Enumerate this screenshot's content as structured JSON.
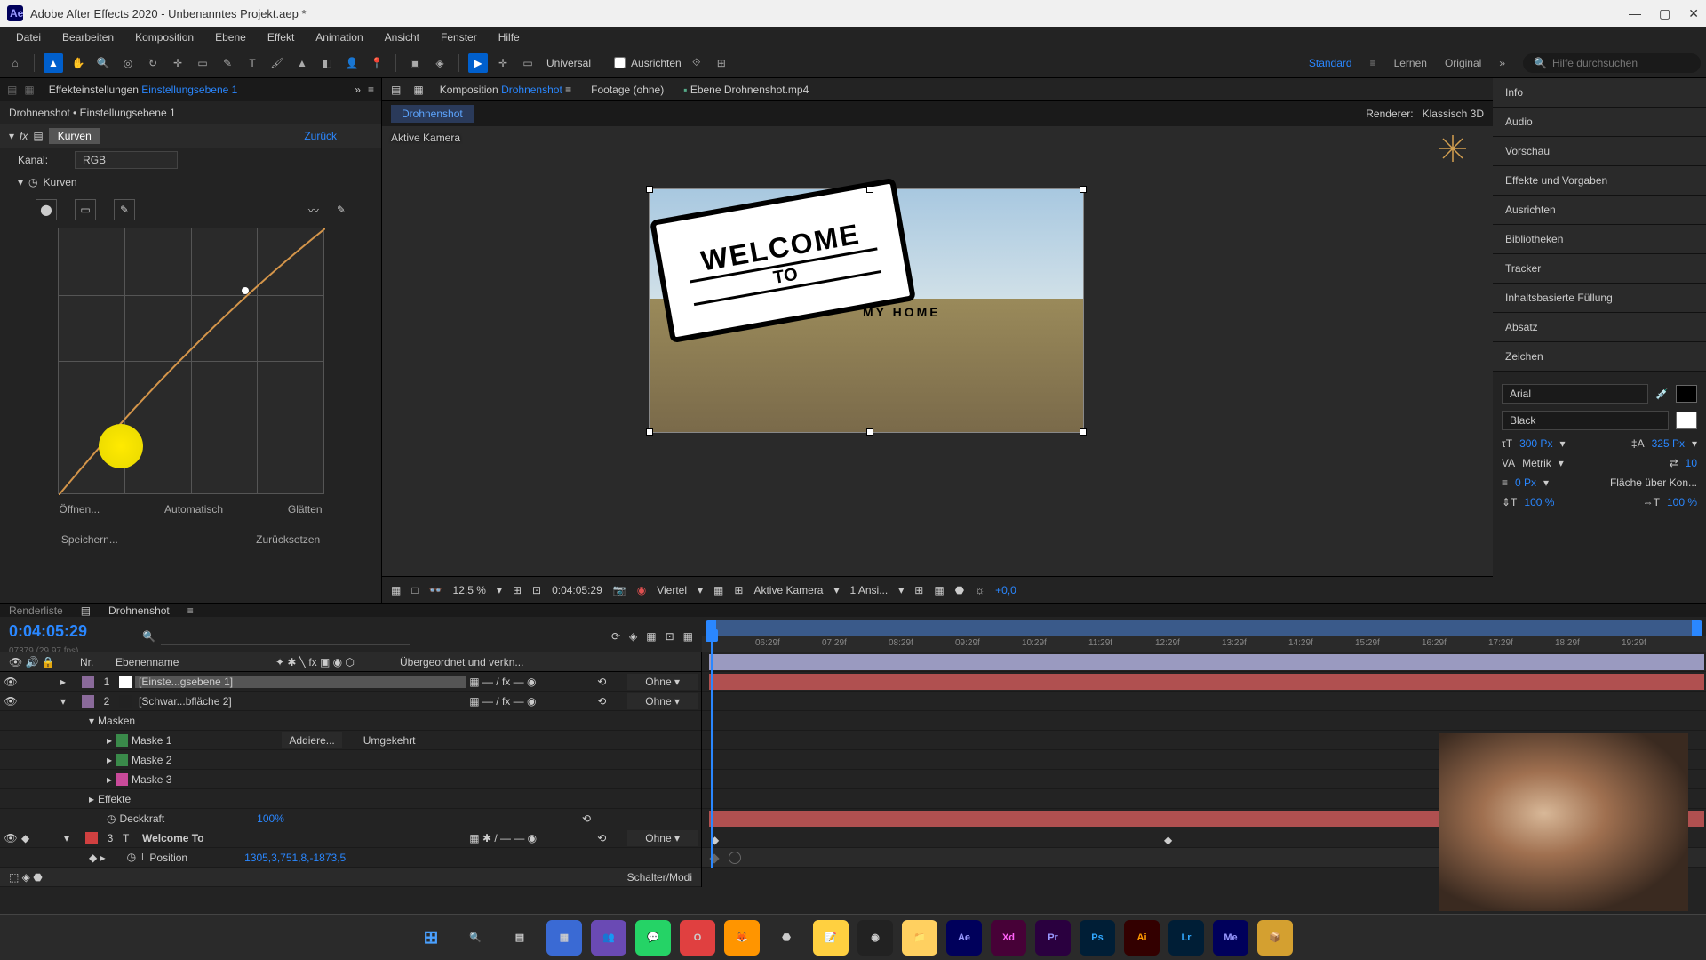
{
  "window": {
    "title": "Adobe After Effects 2020 - Unbenanntes Projekt.aep *"
  },
  "menu": [
    "Datei",
    "Bearbeiten",
    "Komposition",
    "Ebene",
    "Effekt",
    "Animation",
    "Ansicht",
    "Fenster",
    "Hilfe"
  ],
  "toolbar": {
    "universal": "Universal",
    "ausrichten": "Ausrichten",
    "standard": "Standard",
    "lernen": "Lernen",
    "original": "Original",
    "search": "Hilfe durchsuchen"
  },
  "effectPanel": {
    "tabLabel": "Effekteinstellungen",
    "tabHighlight": "Einstellungsebene 1",
    "breadcrumb": "Drohnenshot • Einstellungsebene 1",
    "effectName": "Kurven",
    "reset": "Zurück",
    "channelLbl": "Kanal:",
    "channelVal": "RGB",
    "curvesLbl": "Kurven",
    "buttons": {
      "open": "Öffnen...",
      "auto": "Automatisch",
      "smooth": "Glätten",
      "save": "Speichern...",
      "reset": "Zurücksetzen"
    }
  },
  "composition": {
    "tabComp": "Komposition",
    "tabCompName": "Drohnenshot",
    "tabFootage": "Footage",
    "tabFootageVal": "(ohne)",
    "tabEbene": "Ebene",
    "tabEbeneVal": "Drohnenshot.mp4",
    "breadcrumb": "Drohnenshot",
    "rendererLbl": "Renderer:",
    "rendererVal": "Klassisch 3D",
    "activeCam": "Aktive Kamera",
    "signLine1": "WELCOME",
    "signLine2": "TO",
    "myhome": "MY HOME",
    "zoom": "12,5 %",
    "time": "0:04:05:29",
    "viertel": "Viertel",
    "aktiveKam": "Aktive Kamera",
    "ansicht": "1 Ansi...",
    "exposure": "+0,0"
  },
  "rightPanels": [
    "Info",
    "Audio",
    "Vorschau",
    "Effekte und Vorgaben",
    "Ausrichten",
    "Bibliotheken",
    "Tracker",
    "Inhaltsbasierte Füllung",
    "Absatz",
    "Zeichen"
  ],
  "character": {
    "font": "Arial",
    "style": "Black",
    "size": "300 Px",
    "leading": "325 Px",
    "kerning": "Metrik",
    "tracking": "10",
    "baseline": "0 Px",
    "fill": "Fläche über Kon...",
    "scaleH": "100 %",
    "scaleV": "100 %"
  },
  "timeline": {
    "renderlist": "Renderliste",
    "compName": "Drohnenshot",
    "timecode": "0:04:05:29",
    "timecodeSub": "07379 (29,97 fps)",
    "ruler": [
      "06:29f",
      "07:29f",
      "08:29f",
      "09:29f",
      "10:29f",
      "11:29f",
      "12:29f",
      "13:29f",
      "14:29f",
      "15:29f",
      "16:29f",
      "17:29f",
      "18:29f",
      "19:29f"
    ],
    "cols": {
      "nr": "Nr.",
      "name": "Ebenenname",
      "parent": "Übergeordnet und verkn..."
    },
    "parentNone": "Ohne",
    "layers": [
      {
        "num": "1",
        "name": "[Einste...gsebene 1]",
        "parent": "Ohne",
        "color": "#fff"
      },
      {
        "num": "2",
        "name": "[Schwar...bfläche 2]",
        "parent": "Ohne",
        "color": "#222"
      }
    ],
    "masks": "Masken",
    "mask1": "Maske 1",
    "mask2": "Maske 2",
    "mask3": "Maske 3",
    "maskMode": "Addiere...",
    "maskInvert": "Umgekehrt",
    "effects": "Effekte",
    "opacity": "Deckkraft",
    "opacityVal": "100%",
    "layer3": {
      "num": "3",
      "name": "Welcome To",
      "parent": "Ohne"
    },
    "position": "Position",
    "positionVal": "1305,3,751,8,-1873,5",
    "switchMode": "Schalter/Modi"
  }
}
